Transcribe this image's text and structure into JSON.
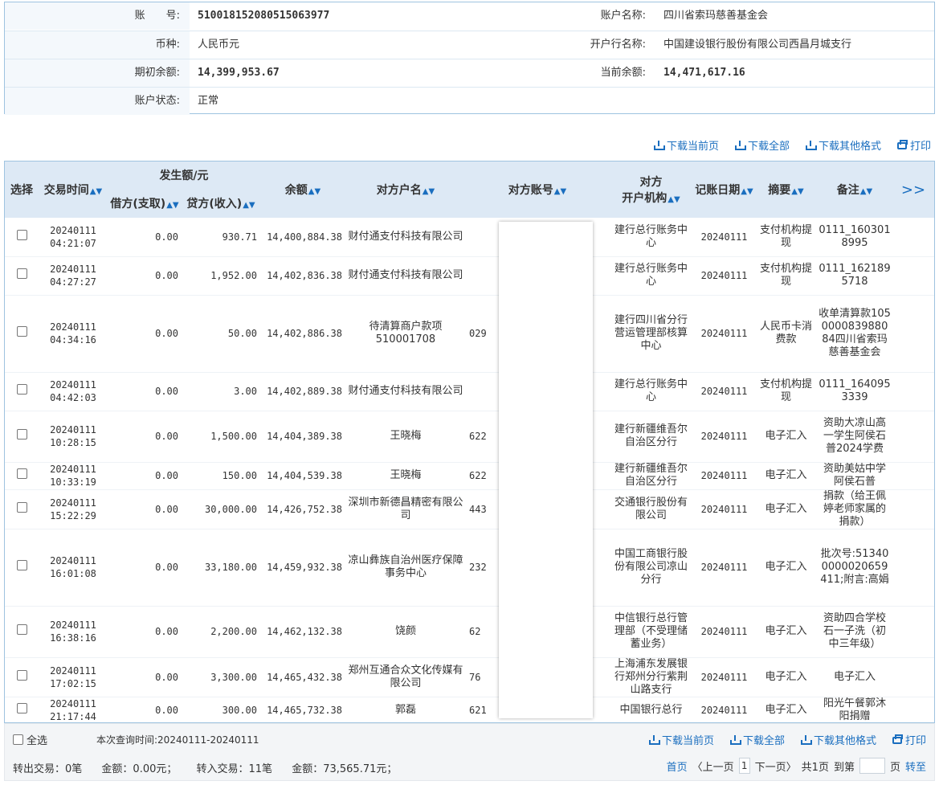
{
  "account": {
    "no_label": "账　　号:",
    "no_value": "510018152080515063977",
    "name_label": "账户名称:",
    "name_value": "四川省索玛慈善基金会",
    "currency_label": "币种:",
    "currency_value": "人民币元",
    "bank_label": "开户行名称:",
    "bank_value": "中国建设银行股份有限公司西昌月城支行",
    "opening_label": "期初余额:",
    "opening_value": "14,399,953.67",
    "current_label": "当前余额:",
    "current_value": "14,471,617.16",
    "status_label": "账户状态:",
    "status_value": "正常"
  },
  "toolbar": {
    "download_page": "下载当前页",
    "download_all": "下载全部",
    "download_other": "下载其他格式",
    "print": "打印"
  },
  "table": {
    "headers": {
      "select": "选择",
      "time": "交易时间",
      "amount_group": "发生额/元",
      "debit": "借方(支取)",
      "credit": "贷方(收入)",
      "balance": "余额",
      "counterparty": "对方户名",
      "cp_account": "对方账号",
      "cp_bank_1": "对方",
      "cp_bank_2": "开户机构",
      "post_date": "记账日期",
      "summary": "摘要",
      "remark": "备注",
      "more": ">>"
    },
    "rows": [
      {
        "date": "20240111",
        "time": "04:21:07",
        "debit": "0.00",
        "credit": "930.71",
        "balance": "14,400,884.38",
        "name": "财付通支付科技有限公司",
        "acct": "",
        "bank": "建行总行账务中心",
        "post": "20240111",
        "summary": "支付机构提现",
        "remark": "0111_1603018995"
      },
      {
        "date": "20240111",
        "time": "04:27:27",
        "debit": "0.00",
        "credit": "1,952.00",
        "balance": "14,402,836.38",
        "name": "财付通支付科技有限公司",
        "acct": "",
        "bank": "建行总行账务中心",
        "post": "20240111",
        "summary": "支付机构提现",
        "remark": "0111_1621895718"
      },
      {
        "date": "20240111",
        "time": "04:34:16",
        "debit": "0.00",
        "credit": "50.00",
        "balance": "14,402,886.38",
        "name": "待清算商户款项510001708",
        "acct": "029",
        "bank": "建行四川省分行营运管理部核算中心",
        "post": "20240111",
        "summary": "人民币卡消费款",
        "remark": "收单清算款105000083988084四川省索玛慈善基金会"
      },
      {
        "date": "20240111",
        "time": "04:42:03",
        "debit": "0.00",
        "credit": "3.00",
        "balance": "14,402,889.38",
        "name": "财付通支付科技有限公司",
        "acct": "",
        "bank": "建行总行账务中心",
        "post": "20240111",
        "summary": "支付机构提现",
        "remark": "0111_1640953339"
      },
      {
        "date": "20240111",
        "time": "10:28:15",
        "debit": "0.00",
        "credit": "1,500.00",
        "balance": "14,404,389.38",
        "name": "王晓梅",
        "acct": "622",
        "bank": "建行新疆维吾尔自治区分行",
        "post": "20240111",
        "summary": "电子汇入",
        "remark": "资助大凉山高一学生阿侯石普2024学费"
      },
      {
        "date": "20240111",
        "time": "10:33:19",
        "debit": "0.00",
        "credit": "150.00",
        "balance": "14,404,539.38",
        "name": "王晓梅",
        "acct": "622",
        "bank": "建行新疆维吾尔自治区分行",
        "post": "20240111",
        "summary": "电子汇入",
        "remark": "资助美姑中学阿侯石普"
      },
      {
        "date": "20240111",
        "time": "15:22:29",
        "debit": "0.00",
        "credit": "30,000.00",
        "balance": "14,426,752.38",
        "name": "深圳市新德昌精密有限公司",
        "acct": "443",
        "bank": "交通银行股份有限公司",
        "post": "20240111",
        "summary": "电子汇入",
        "remark": "捐款（给王佩婷老师家属的捐款）"
      },
      {
        "date": "20240111",
        "time": "16:01:08",
        "debit": "0.00",
        "credit": "33,180.00",
        "balance": "14,459,932.38",
        "name": "凉山彝族自治州医疗保障事务中心",
        "acct": "232",
        "bank": "中国工商银行股份有限公司凉山分行",
        "post": "20240111",
        "summary": "电子汇入",
        "remark": "批次号:513400000020659411;附言:高娟"
      },
      {
        "date": "20240111",
        "time": "16:38:16",
        "debit": "0.00",
        "credit": "2,200.00",
        "balance": "14,462,132.38",
        "name": "饶颜",
        "acct": "62",
        "bank": "中信银行总行管理部（不受理储蓄业务）",
        "post": "20240111",
        "summary": "电子汇入",
        "remark": "资助四合学校石一子洗（初中三年级）"
      },
      {
        "date": "20240111",
        "time": "17:02:15",
        "debit": "0.00",
        "credit": "3,300.00",
        "balance": "14,465,432.38",
        "name": "郑州互通合众文化传媒有限公司",
        "acct": "76",
        "bank": "上海浦东发展银行郑州分行紫荆山路支行",
        "post": "20240111",
        "summary": "电子汇入",
        "remark": "电子汇入"
      },
      {
        "date": "20240111",
        "time": "21:17:44",
        "debit": "0.00",
        "credit": "300.00",
        "balance": "14,465,732.38",
        "name": "郭磊",
        "acct": "621",
        "bank": "中国银行总行",
        "post": "20240111",
        "summary": "电子汇入",
        "remark": "阳光午餐郭沐阳捐赠"
      }
    ]
  },
  "footer": {
    "select_all": "全选",
    "query_time": "本次查询时间:20240111-20240111",
    "out_count": "转出交易：0笔",
    "out_amount": "金额：0.00元；",
    "in_count": "转入交易：11笔",
    "in_amount": "金额：73,565.71元；",
    "first": "首页",
    "prev": "〈上一页",
    "page": "1",
    "next": "下一页〉",
    "total": "共1页",
    "goto": "到第",
    "page_unit": "页",
    "go": "转至"
  }
}
